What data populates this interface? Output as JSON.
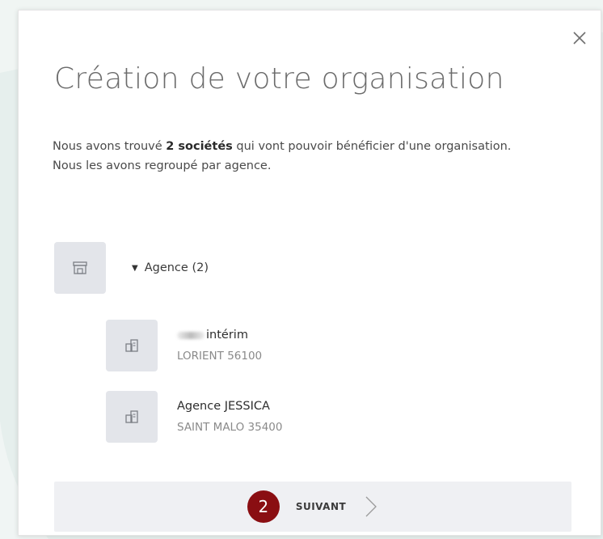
{
  "dialog": {
    "title": "Création de votre organisation",
    "close_icon": "close-icon",
    "intro": {
      "part1": "Nous avons trouvé ",
      "count_bold": "2 sociétés",
      "part2": " qui vont pouvoir bénéficier d'une organisation.",
      "line2": "Nous les avons regroupé par agence."
    },
    "group": {
      "icon": "store-icon",
      "caret": "▼",
      "label": "Agence (2)"
    },
    "companies": [
      {
        "icon": "buildings-icon",
        "name_suffix": "intérim",
        "city": "LORIENT 56100"
      },
      {
        "icon": "buildings-icon",
        "name": "Agence JESSICA",
        "city": "SAINT MALO 35400"
      }
    ],
    "footer": {
      "step_number": "2",
      "next_label": "SUIVANT",
      "next_icon": "chevron-right-icon"
    }
  },
  "colors": {
    "background": "#e6efed",
    "step_badge": "#8a0e12",
    "icon_box": "#e3e5ea",
    "footer_bg": "#eff0f3"
  }
}
